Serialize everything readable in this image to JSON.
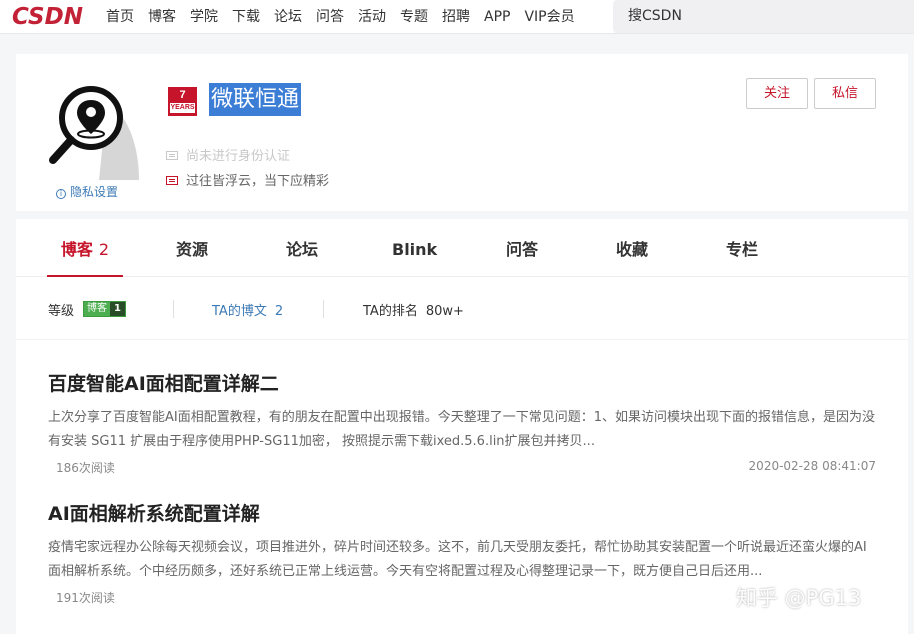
{
  "topnav": {
    "logo": "CSDN",
    "links": [
      "首页",
      "博客",
      "学院",
      "下载",
      "论坛",
      "问答",
      "活动",
      "专题",
      "招聘",
      "APP",
      "VIP会员"
    ],
    "search_text": "搜CSDN"
  },
  "profile": {
    "years_num": "7",
    "years_label": "YEARS",
    "username": "微联恒通",
    "cert_text": "尚未进行身份认证",
    "signature": "过往皆浮云，当下应精彩",
    "privacy_label": "隐私设置",
    "follow_label": "关注",
    "message_label": "私信"
  },
  "tabs": [
    {
      "label": "博客",
      "count": "2"
    },
    {
      "label": "资源"
    },
    {
      "label": "论坛"
    },
    {
      "label": "Blink"
    },
    {
      "label": "问答"
    },
    {
      "label": "收藏"
    },
    {
      "label": "专栏"
    }
  ],
  "stats": {
    "level_label": "等级",
    "level_badge_text": "博客",
    "level_badge_num": "1",
    "posts_label": "TA的博文",
    "posts_count": "2",
    "rank_label": "TA的排名",
    "rank_value": "80w+"
  },
  "articles": [
    {
      "title": "百度智能AI面相配置详解二",
      "summary": "上次分享了百度智能AI面相配置教程，有的朋友在配置中出现报错。今天整理了一下常见问题：1、如果访问模块出现下面的报错信息，是因为没有安装 SG11 扩展由于程序使用PHP-SG11加密， 按照提示需下载ixed.5.6.lin扩展包并拷贝...",
      "reads": "186次阅读",
      "date": "2020-02-28 08:41:07"
    },
    {
      "title": "AI面相解析系统配置详解",
      "summary": "疫情宅家远程办公除每天视频会议，项目推进外，碎片时间还较多。这不，前几天受朋友委托，帮忙协助其安装配置一个听说最近还蛮火爆的AI面相解析系统。个中经历颇多，还好系统已正常上线运营。今天有空将配置过程及心得整理记录一下，既方便自己日后还用...",
      "reads": "191次阅读",
      "date": ""
    }
  ],
  "watermark": "知乎 @PG13",
  "colors": {
    "brand_red": "#c6152b",
    "link_blue": "#3d7ab5",
    "selection_blue": "#3c7ed6",
    "level_green": "#4cae4f"
  }
}
